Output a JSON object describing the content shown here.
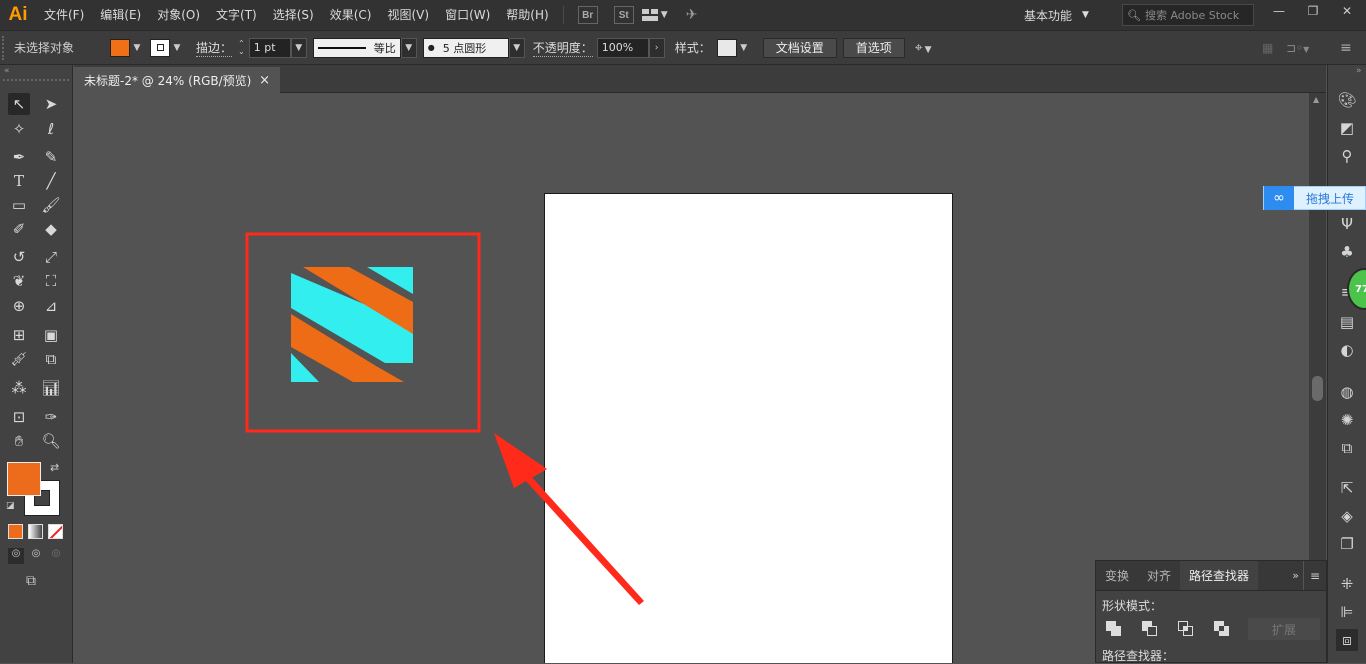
{
  "menubar": {
    "logo": "Ai",
    "items": [
      "文件(F)",
      "编辑(E)",
      "对象(O)",
      "文字(T)",
      "选择(S)",
      "效果(C)",
      "视图(V)",
      "窗口(W)",
      "帮助(H)"
    ],
    "bridge": "Br",
    "stock": "St",
    "workspace": "基本功能",
    "search_placeholder": "搜索 Adobe Stock"
  },
  "control": {
    "no_selection": "未选择对象",
    "stroke_label": "描边：",
    "stroke_value": "1 pt",
    "profile_label": "等比",
    "brush_label": "5 点圆形",
    "opacity_label": "不透明度：",
    "opacity_value": "100%",
    "style_label": "样式：",
    "doc_settings": "文档设置",
    "preferences": "首选项",
    "fill_color": "#f07018"
  },
  "document": {
    "tab_title": "未标题-2* @ 24% (RGB/预览)",
    "close": "×"
  },
  "colors": {
    "fill": "#ed6c1b",
    "stroke": "#ffffff",
    "cyan": "#33eeee",
    "orange": "#ee6c16",
    "highlight": "#ff2a1a"
  },
  "upload_widget": "拖拽上传",
  "badge_number": "77",
  "pathfinder": {
    "tabs": [
      "变换",
      "对齐",
      "路径查找器"
    ],
    "shape_modes": "形状模式：",
    "expand": "扩展",
    "pathfinders": "路径查找器："
  }
}
